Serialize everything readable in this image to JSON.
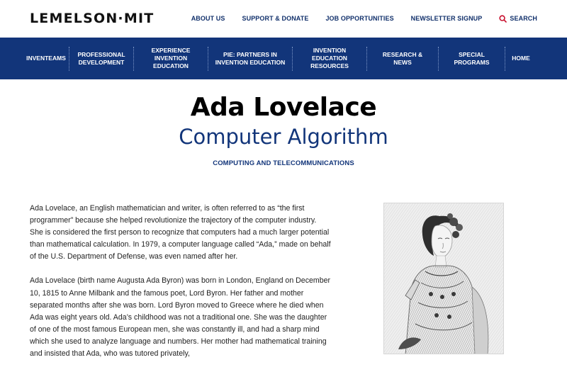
{
  "brand": {
    "logo_text": "LEMELSON·MIT"
  },
  "top_links": {
    "about": "ABOUT US",
    "support": "SUPPORT & DONATE",
    "jobs": "JOB OPPORTUNITIES",
    "newsletter": "NEWSLETTER SIGNUP",
    "search": "SEARCH"
  },
  "nav": {
    "items": [
      {
        "label": "INVENTEAMS"
      },
      {
        "label": "PROFESSIONAL DEVELOPMENT"
      },
      {
        "label": "EXPERIENCE INVENTION EDUCATION"
      },
      {
        "label": "PIE: PARTNERS IN INVENTION EDUCATION"
      },
      {
        "label": "INVENTION EDUCATION RESOURCES"
      },
      {
        "label": "RESEARCH & NEWS"
      },
      {
        "label": "SPECIAL PROGRAMS"
      },
      {
        "label": "HOME"
      }
    ]
  },
  "hero": {
    "name": "Ada Lovelace",
    "invention": "Computer Algorithm",
    "category": "COMPUTING AND TELECOMMUNICATIONS"
  },
  "body": {
    "paragraphs": [
      "Ada Lovelace, an English mathematician and writer, is often referred to as “the first programmer” because she helped revolutionize the trajectory of the computer industry. She is considered the first person to recognize that computers had a much larger potential than mathematical calculation. In 1979, a computer language called “Ada,” made on behalf of the U.S. Department of Defense, was even named after her.",
      "Ada Lovelace (birth name Augusta Ada Byron) was born in London, England on December 10, 1815 to Anne Milbank and the famous poet, Lord Byron. Her father and mother separated months after she was born. Lord Byron moved to Greece where he died when Ada was eight years old. Ada’s childhood was not a traditional one. She was the daughter of one of the most famous European men, she was constantly ill, and had a sharp mind which she used to analyze language and numbers. Her mother had mathematical training and insisted that Ada, who was tutored privately,"
    ]
  },
  "colors": {
    "navy": "#12357a",
    "search_icon": "#c8102e"
  }
}
